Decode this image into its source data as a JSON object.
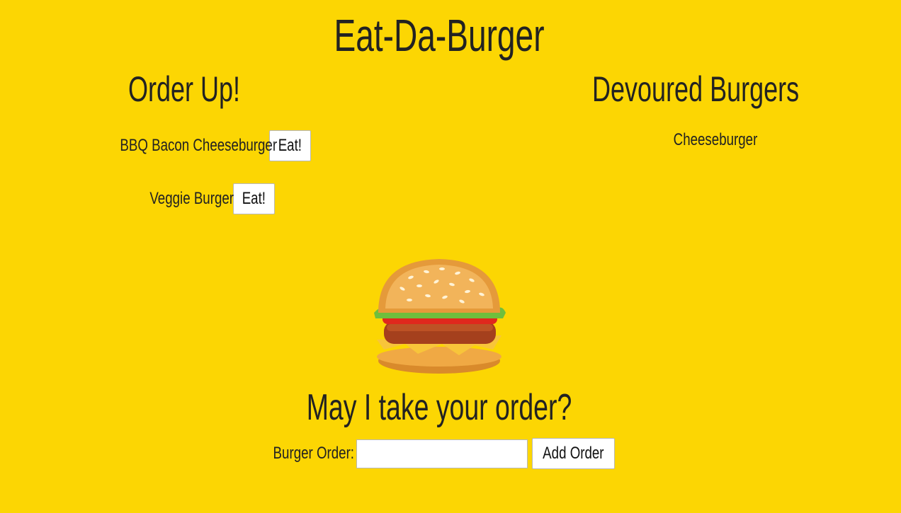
{
  "app": {
    "title": "Eat-Da-Burger"
  },
  "order_up": {
    "heading": "Order Up!",
    "items": [
      {
        "name": "BBQ Bacon Cheeseburger",
        "button_label": "Eat!"
      },
      {
        "name": "Veggie Burger",
        "button_label": "Eat!"
      }
    ]
  },
  "devoured": {
    "heading": "Devoured Burgers",
    "items": [
      {
        "name": "Cheeseburger"
      }
    ]
  },
  "hero": {
    "icon": "hamburger-icon"
  },
  "order_form": {
    "heading": "May I take your order?",
    "label": "Burger Order:",
    "input_value": "",
    "submit_label": "Add Order"
  },
  "colors": {
    "background": "#fcd603",
    "text": "#222222",
    "button_background": "#ffffff"
  }
}
